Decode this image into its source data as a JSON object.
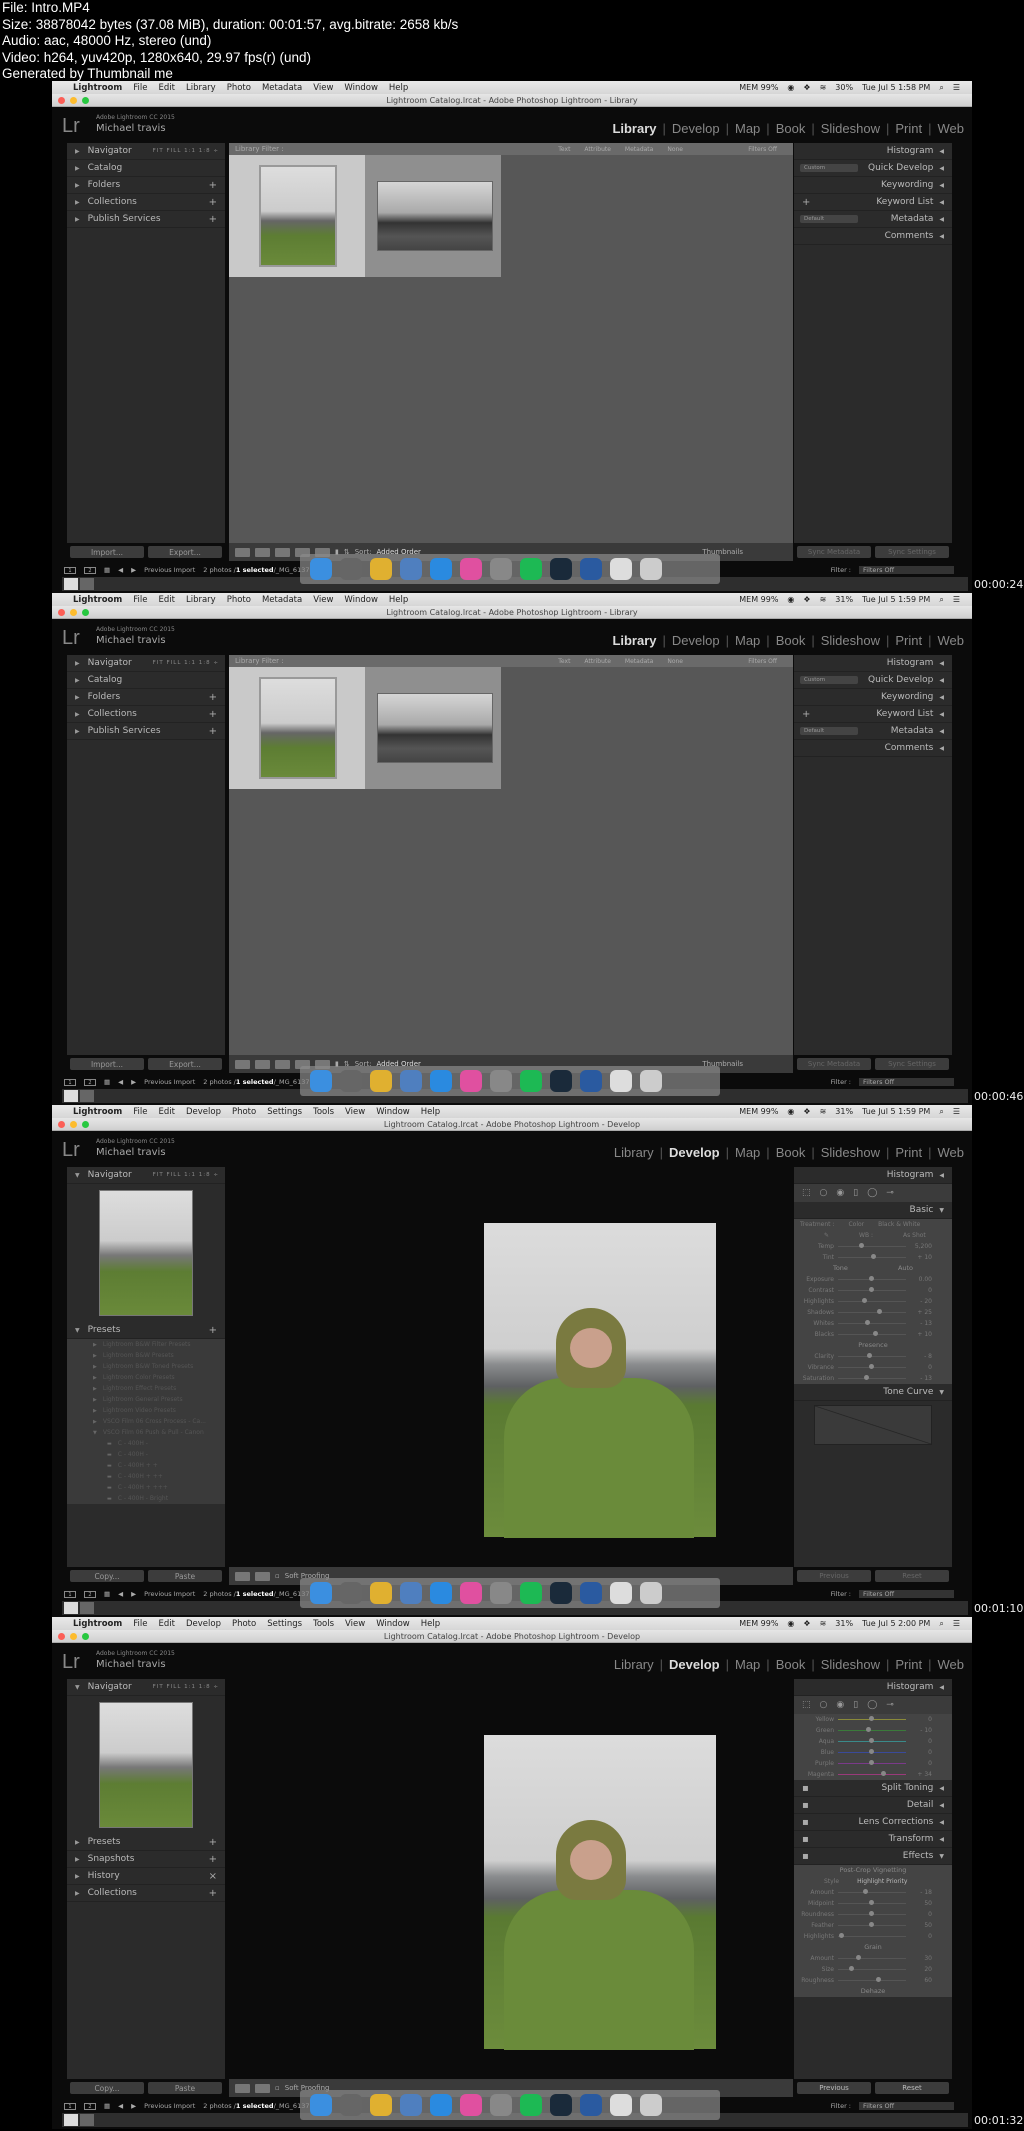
{
  "header": {
    "lines": [
      "File: Intro.MP4",
      "Size: 38878042 bytes (37.08 MiB), duration: 00:01:57, avg.bitrate: 2658 kb/s",
      "Audio: aac, 48000 Hz, stereo (und)",
      "Video: h264, yuv420p, 1280x640, 29.97 fps(r) (und)",
      "Generated by Thumbnail me"
    ]
  },
  "frames": [
    {
      "timestamp": "00:00:24",
      "module": "Library",
      "window_title": "Lightroom Catalog.lrcat - Adobe Photoshop Lightroom - Library",
      "menu": [
        "Lightroom",
        "File",
        "Edit",
        "Library",
        "Photo",
        "Metadata",
        "View",
        "Window",
        "Help"
      ],
      "status": {
        "battery": "30%",
        "datetime": "Tue Jul 5  1:58 PM",
        "mem": "MEM 99%"
      }
    },
    {
      "timestamp": "00:00:46",
      "module": "Library",
      "window_title": "Lightroom Catalog.lrcat - Adobe Photoshop Lightroom - Library",
      "menu": [
        "Lightroom",
        "File",
        "Edit",
        "Library",
        "Photo",
        "Metadata",
        "View",
        "Window",
        "Help"
      ],
      "status": {
        "battery": "31%",
        "datetime": "Tue Jul 5  1:59 PM",
        "mem": "MEM 99%"
      }
    },
    {
      "timestamp": "00:01:10",
      "module": "Develop",
      "window_title": "Lightroom Catalog.lrcat - Adobe Photoshop Lightroom - Develop",
      "menu": [
        "Lightroom",
        "File",
        "Edit",
        "Develop",
        "Photo",
        "Settings",
        "Tools",
        "View",
        "Window",
        "Help"
      ],
      "status": {
        "battery": "31%",
        "datetime": "Tue Jul 5  1:59 PM",
        "mem": "MEM 99%"
      }
    },
    {
      "timestamp": "00:01:32",
      "module": "Develop",
      "window_title": "Lightroom Catalog.lrcat - Adobe Photoshop Lightroom - Develop",
      "menu": [
        "Lightroom",
        "File",
        "Edit",
        "Develop",
        "Photo",
        "Settings",
        "Tools",
        "View",
        "Window",
        "Help"
      ],
      "status": {
        "battery": "31%",
        "datetime": "Tue Jul 5  2:00 PM",
        "mem": "MEM 99%"
      }
    }
  ],
  "identity": {
    "product": "Adobe Lightroom CC 2015",
    "user": "Michael travis",
    "logo": "Lr"
  },
  "modules": [
    "Library",
    "Develop",
    "Map",
    "Book",
    "Slideshow",
    "Print",
    "Web"
  ],
  "library": {
    "left_panels": [
      {
        "label": "Navigator",
        "zooms": "FIT  FILL  1:1  1:8 ÷"
      },
      {
        "label": "Catalog"
      },
      {
        "label": "Folders",
        "plus": "+"
      },
      {
        "label": "Collections",
        "plus": "+"
      },
      {
        "label": "Publish Services",
        "plus": "+"
      }
    ],
    "filter_bar": {
      "label": "Library Filter :",
      "options": [
        "Text",
        "Attribute",
        "Metadata",
        "None"
      ],
      "filters": "Filters Off"
    },
    "right_panels": [
      {
        "label": "Histogram"
      },
      {
        "label": "Quick Develop",
        "select": "Custom"
      },
      {
        "label": "Keywording"
      },
      {
        "label": "Keyword List",
        "plus": "+"
      },
      {
        "label": "Metadata",
        "select": "Default"
      },
      {
        "label": "Comments"
      }
    ],
    "import_label": "Import...",
    "export_label": "Export...",
    "sort_label": "Sort:",
    "sort_value": "Added Order",
    "thumbnails_label": "Thumbnails",
    "sync_metadata": "Sync Metadata",
    "sync_settings": "Sync Settings"
  },
  "filmbar": {
    "source": "Previous Import",
    "count": "2 photos /",
    "selected": "1 selected",
    "file": "/_MG_6137.CR2",
    "filter_label": "Filter :",
    "filter_value": "Filters Off"
  },
  "develop": {
    "navigator": {
      "label": "Navigator",
      "zooms": "FIT  FILL  1:1  1:8 ÷"
    },
    "presets_label": "Presets",
    "presets": [
      "Lightroom B&W Filter Presets",
      "Lightroom B&W Presets",
      "Lightroom B&W Toned Presets",
      "Lightroom Color Presets",
      "Lightroom Effect Presets",
      "Lightroom General Presets",
      "Lightroom Video Presets",
      "VSCO Film 06 Cross Process - Ca...",
      "VSCO Film 06 Push & Pull - Canon"
    ],
    "preset_items": [
      "C - 400H -",
      "C - 400H -",
      "C - 400H + +",
      "C - 400H + ++",
      "C - 400H + +++",
      "C - 400H - Bright"
    ],
    "left_panels_collapsed": [
      {
        "label": "Presets",
        "icon": "+"
      },
      {
        "label": "Snapshots",
        "icon": "+"
      },
      {
        "label": "History",
        "icon": "×"
      },
      {
        "label": "Collections",
        "icon": "+"
      }
    ],
    "copy_label": "Copy...",
    "paste_label": "Paste",
    "soft_proofing": "Soft Proofing",
    "histogram": "Histogram",
    "basic": {
      "label": "Basic",
      "treatment": "Treatment :",
      "color": "Color",
      "bw": "Black & White",
      "wb": "WB :",
      "wb_value": "As Shot",
      "sliders": [
        {
          "label": "Temp",
          "value": "5,200",
          "pos": 0.35
        },
        {
          "label": "Tint",
          "value": "+ 10",
          "pos": 0.52
        },
        {
          "label": "Exposure",
          "value": "0.00",
          "pos": 0.5
        },
        {
          "label": "Contrast",
          "value": "0",
          "pos": 0.5
        },
        {
          "label": "Highlights",
          "value": "- 20",
          "pos": 0.4
        },
        {
          "label": "Shadows",
          "value": "+ 25",
          "pos": 0.62
        },
        {
          "label": "Whites",
          "value": "- 13",
          "pos": 0.44
        },
        {
          "label": "Blacks",
          "value": "+ 10",
          "pos": 0.55
        }
      ],
      "tone": "Tone",
      "auto": "Auto",
      "presence": "Presence",
      "presence_sliders": [
        {
          "label": "Clarity",
          "value": "- 8",
          "pos": 0.46
        },
        {
          "label": "Vibrance",
          "value": "0",
          "pos": 0.5
        },
        {
          "label": "Saturation",
          "value": "- 13",
          "pos": 0.42
        }
      ]
    },
    "tone_curve": "Tone Curve",
    "hsl_sliders": [
      {
        "label": "Yellow",
        "value": "0",
        "pos": 0.5,
        "color": "#8a8a3a"
      },
      {
        "label": "Green",
        "value": "- 10",
        "pos": 0.45,
        "color": "#3a7a3a"
      },
      {
        "label": "Aqua",
        "value": "0",
        "pos": 0.5,
        "color": "#3a8a8a"
      },
      {
        "label": "Blue",
        "value": "0",
        "pos": 0.5,
        "color": "#3a4a9a"
      },
      {
        "label": "Purple",
        "value": "0",
        "pos": 0.5,
        "color": "#7a3a8a"
      },
      {
        "label": "Magenta",
        "value": "+ 34",
        "pos": 0.67,
        "color": "#9a3a7a"
      }
    ],
    "panels": [
      "Split Toning",
      "Detail",
      "Lens Corrections",
      "Transform",
      "Effects"
    ],
    "vignette": {
      "title": "Post-Crop Vignetting",
      "style_label": "Style",
      "style_value": "Highlight Priority",
      "sliders": [
        {
          "label": "Amount",
          "value": "- 18",
          "pos": 0.41
        },
        {
          "label": "Midpoint",
          "value": "50",
          "pos": 0.5
        },
        {
          "label": "Roundness",
          "value": "0",
          "pos": 0.5
        },
        {
          "label": "Feather",
          "value": "50",
          "pos": 0.5
        },
        {
          "label": "Highlights",
          "value": "0",
          "pos": 0.05
        }
      ]
    },
    "grain": {
      "title": "Grain",
      "sliders": [
        {
          "label": "Amount",
          "value": "30",
          "pos": 0.3
        },
        {
          "label": "Size",
          "value": "20",
          "pos": 0.2
        },
        {
          "label": "Roughness",
          "value": "60",
          "pos": 0.6
        }
      ]
    },
    "dehaze": "Dehaze",
    "previous_label": "Previous",
    "reset_label": "Reset"
  }
}
